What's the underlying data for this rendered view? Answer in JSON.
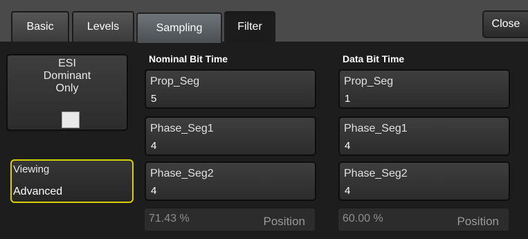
{
  "tabs": [
    {
      "label": "Basic"
    },
    {
      "label": "Levels"
    },
    {
      "label": "Sampling"
    },
    {
      "label": "Filter"
    }
  ],
  "close_label": "Close",
  "esi": {
    "line1": "ESI",
    "line2": "Dominant",
    "line3": "Only",
    "checked": false
  },
  "viewing": {
    "label": "Viewing",
    "value": "Advanced"
  },
  "nominal": {
    "header": "Nominal Bit Time",
    "prop_seg": {
      "label": "Prop_Seg",
      "value": "5"
    },
    "phase_seg1": {
      "label": "Phase_Seg1",
      "value": "4"
    },
    "phase_seg2": {
      "label": "Phase_Seg2",
      "value": "4"
    },
    "percent": "71.43 %",
    "position_label": "Position"
  },
  "data": {
    "header": "Data Bit Time",
    "prop_seg": {
      "label": "Prop_Seg",
      "value": "1"
    },
    "phase_seg1": {
      "label": "Phase_Seg1",
      "value": "4"
    },
    "phase_seg2": {
      "label": "Phase_Seg2",
      "value": "4"
    },
    "percent": "60.00 %",
    "position_label": "Position"
  }
}
